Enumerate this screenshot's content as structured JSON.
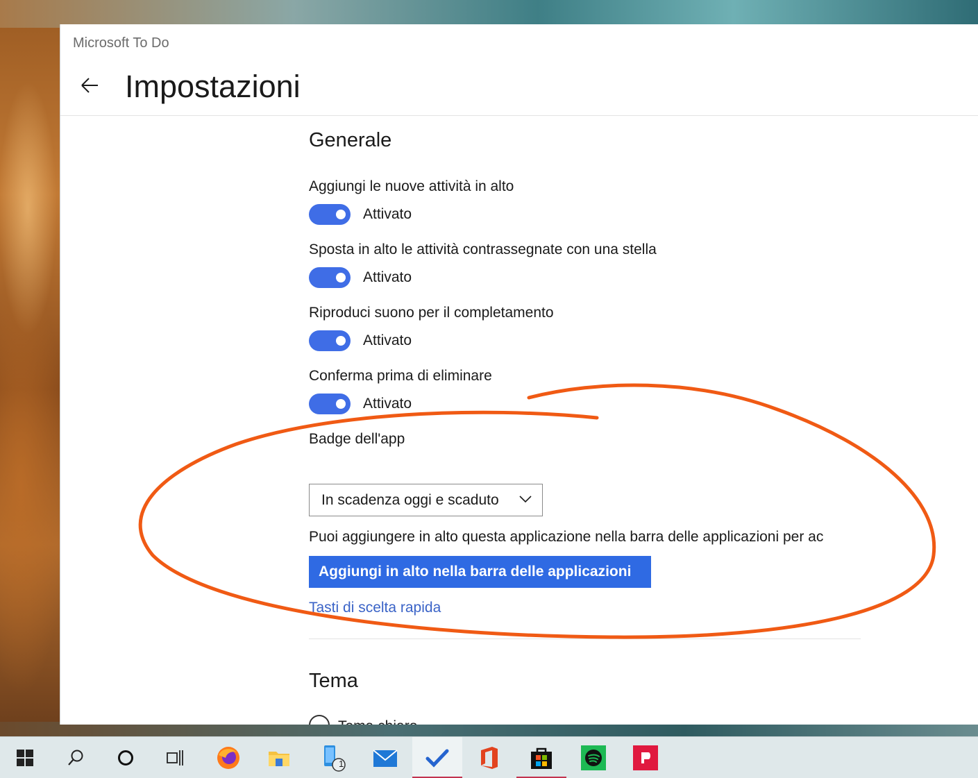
{
  "window": {
    "app_title": "Microsoft To Do",
    "page_title": "Impostazioni"
  },
  "general": {
    "section_title": "Generale",
    "toggles": [
      {
        "label": "Aggiungi le nuove attività in alto",
        "state": "Attivato",
        "on": true
      },
      {
        "label": "Sposta in alto le attività contrassegnate con una stella",
        "state": "Attivato",
        "on": true
      },
      {
        "label": "Riproduci suono per il completamento",
        "state": "Attivato",
        "on": true
      },
      {
        "label": "Conferma prima di eliminare",
        "state": "Attivato",
        "on": true
      }
    ],
    "badge_label": "Badge dell'app",
    "badge_value": "In scadenza oggi e scaduto",
    "pin_description": "Puoi aggiungere in alto questa applicazione nella barra delle applicazioni per ac",
    "pin_button": "Aggiungi in alto nella barra delle applicazioni",
    "shortcuts_link": "Tasti di scelta rapida"
  },
  "theme": {
    "section_title": "Tema",
    "option_light": "Tema chiaro"
  },
  "taskbar": {
    "phone_badge": "1"
  },
  "colors": {
    "accent": "#3f6de6",
    "button": "#2f6ae3",
    "link": "#3a63c7",
    "annotation": "#f05a14"
  }
}
